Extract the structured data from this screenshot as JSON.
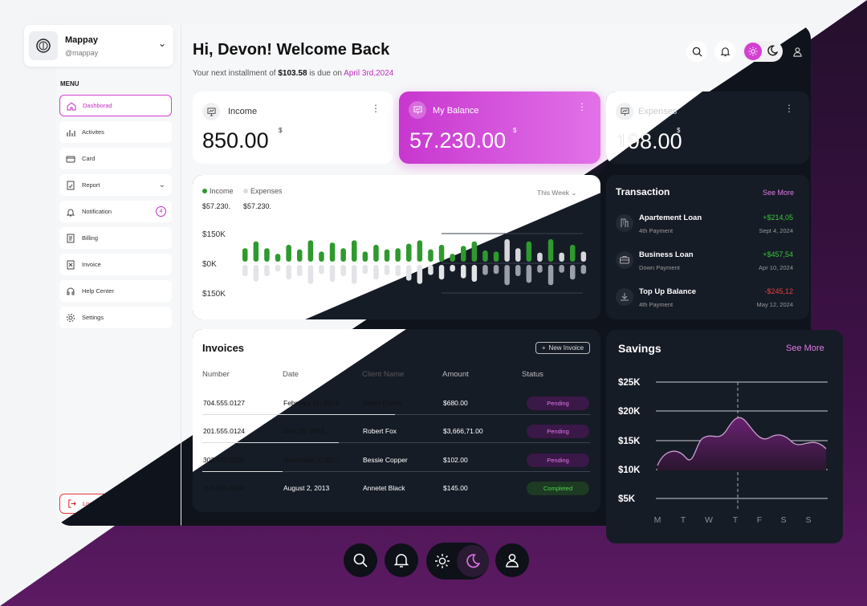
{
  "profile": {
    "name": "Mappay",
    "handle": "@mappay"
  },
  "menu_title": "MENU",
  "nav": [
    {
      "label": "Dashborad",
      "icon": "home-icon",
      "active": true
    },
    {
      "label": "Activites",
      "icon": "bar-chart-icon"
    },
    {
      "label": "Card",
      "icon": "card-icon"
    },
    {
      "label": "Report",
      "icon": "report-icon",
      "chevron": true
    },
    {
      "label": "Notification",
      "icon": "bell-icon",
      "badge": "4"
    },
    {
      "label": "Billing",
      "icon": "billing-icon"
    },
    {
      "label": "Invoice",
      "icon": "invoice-icon"
    },
    {
      "label": "Help Center",
      "icon": "headset-icon"
    },
    {
      "label": "Settings",
      "icon": "gear-icon"
    }
  ],
  "logout": "Log out",
  "header": {
    "greeting": "Hi, Devon! Welcome Back",
    "sub_pre": "Your next installment of ",
    "amount": "$103.58",
    "sub_mid": " is due on ",
    "date": "April 3rd,2024"
  },
  "stats": {
    "income": {
      "label": "Income",
      "value": "850.00",
      "cur": "$"
    },
    "balance": {
      "label": "My Balance",
      "value": "57.230.00",
      "cur": "$"
    },
    "expenses": {
      "label": "Expenses",
      "value": "198.00",
      "cur": "$"
    }
  },
  "overview": {
    "legend_income": "Income",
    "legend_expenses": "Expenses",
    "income_val": "$57.230.",
    "expenses_val": "$57.230.",
    "period": "This Week",
    "yticks": [
      "$150K",
      "$0K",
      "$150K"
    ]
  },
  "chart_data": {
    "type": "bar",
    "title": "",
    "series": [
      {
        "name": "Income",
        "values": [
          0.6,
          0.9,
          0.6,
          0.35,
          0.75,
          0.55,
          0.95,
          0.45,
          0.85,
          0.6,
          0.95,
          0.45,
          0.75,
          0.55,
          0.6,
          0.8,
          0.95,
          0.55,
          0.75,
          0.35,
          0.7,
          0.9,
          0.5,
          0.45,
          1.0,
          0.6,
          0.9,
          0.4,
          1.0,
          0.4,
          0.75,
          0.45
        ]
      },
      {
        "name": "Expenses",
        "values": [
          0.5,
          0.75,
          0.5,
          0.3,
          0.65,
          0.5,
          0.85,
          0.4,
          0.75,
          0.5,
          0.85,
          0.4,
          0.65,
          0.45,
          0.5,
          0.7,
          0.85,
          0.45,
          0.65,
          0.3,
          0.6,
          0.75,
          0.45,
          0.4,
          0.9,
          0.5,
          0.8,
          0.35,
          0.9,
          0.35,
          0.65,
          0.4
        ]
      }
    ],
    "ylabel": "",
    "yticks": [
      "$150K",
      "$0K",
      "$150K"
    ]
  },
  "transactions": {
    "title": "Transaction",
    "see_more": "See More",
    "items": [
      {
        "name": "Apartement Loan",
        "sub": "4th Payment",
        "amount": "+$214,05",
        "date": "Sept 4, 2024",
        "pos": true,
        "icon": "building-icon"
      },
      {
        "name": "Business Loan",
        "sub": "Down Payment",
        "amount": "+$457,54",
        "date": "Apr 10, 2024",
        "pos": true,
        "icon": "briefcase-icon"
      },
      {
        "name": "Top Up Balance",
        "sub": "4th Payment",
        "amount": "-$245,12",
        "date": "May 12, 2024",
        "pos": false,
        "icon": "download-icon"
      }
    ]
  },
  "invoices": {
    "title": "Invoices",
    "new_btn": "New Invoice",
    "columns": [
      "Number",
      "Date",
      "Client Name",
      "Amount",
      "Status"
    ],
    "rows": [
      {
        "number": "704.555.0127",
        "date": "February 11, 2014",
        "client": "Albert Flores",
        "amount": "$680.00",
        "status": "Pending"
      },
      {
        "number": "201.555.0124",
        "date": "May 31, 2015",
        "client": "Robert Fox",
        "amount": "$3,666,71.00",
        "status": "Pending"
      },
      {
        "number": "303.555.0105",
        "date": "November 7, 2017",
        "client": "Bessie Copper",
        "amount": "$102.00",
        "status": "Pending"
      },
      {
        "number": "205.555.0100",
        "date": "August 2, 2013",
        "client": "Annetet Black",
        "amount": "$145.00",
        "status": "Completed"
      }
    ]
  },
  "savings": {
    "title": "Savings",
    "see_more": "See More",
    "yticks": [
      "$25K",
      "$20K",
      "$15K",
      "$10K",
      "$5K"
    ],
    "xticks": [
      "M",
      "T",
      "W",
      "T",
      "F",
      "S",
      "S"
    ],
    "chart_data": {
      "type": "area",
      "categories": [
        "M",
        "T",
        "W",
        "T",
        "F",
        "S",
        "S"
      ],
      "values": [
        11,
        16,
        16,
        19.5,
        15.5,
        15.5,
        14
      ],
      "ylim": [
        5,
        25
      ]
    }
  },
  "colors": {
    "accent": "#d43fd0",
    "green": "#2e9a2e",
    "red": "#e04040",
    "dark_card": "#161c26"
  }
}
